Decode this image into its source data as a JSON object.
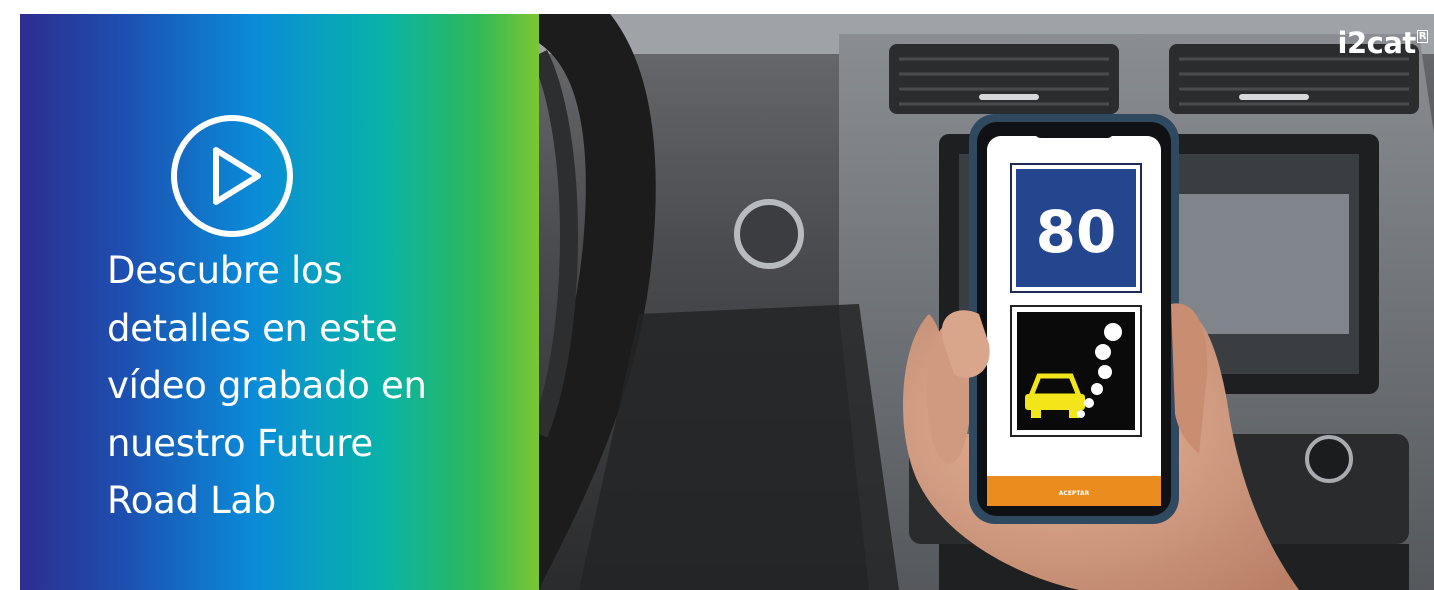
{
  "promo": {
    "lines": [
      "Descubre los",
      "detalles en este",
      "vídeo grabado en",
      "nuestro Future",
      "Road Lab"
    ],
    "play_icon": "play-circle-icon"
  },
  "video": {
    "brand_name": "i2cat",
    "brand_mark": "R",
    "phone_screen": {
      "speed_sign_value": "80",
      "hazard_sign_icon": "car-skidding-icon",
      "accept_button_label": "ACEPTAR"
    }
  },
  "colors": {
    "gradient": [
      "#2e2d8f",
      "#0a8bd8",
      "#08b3a8",
      "#7cc631"
    ],
    "speed_sign_blue": "#23468f",
    "hazard_yellow": "#f2e51a",
    "accept_orange": "#ea8c1e"
  }
}
